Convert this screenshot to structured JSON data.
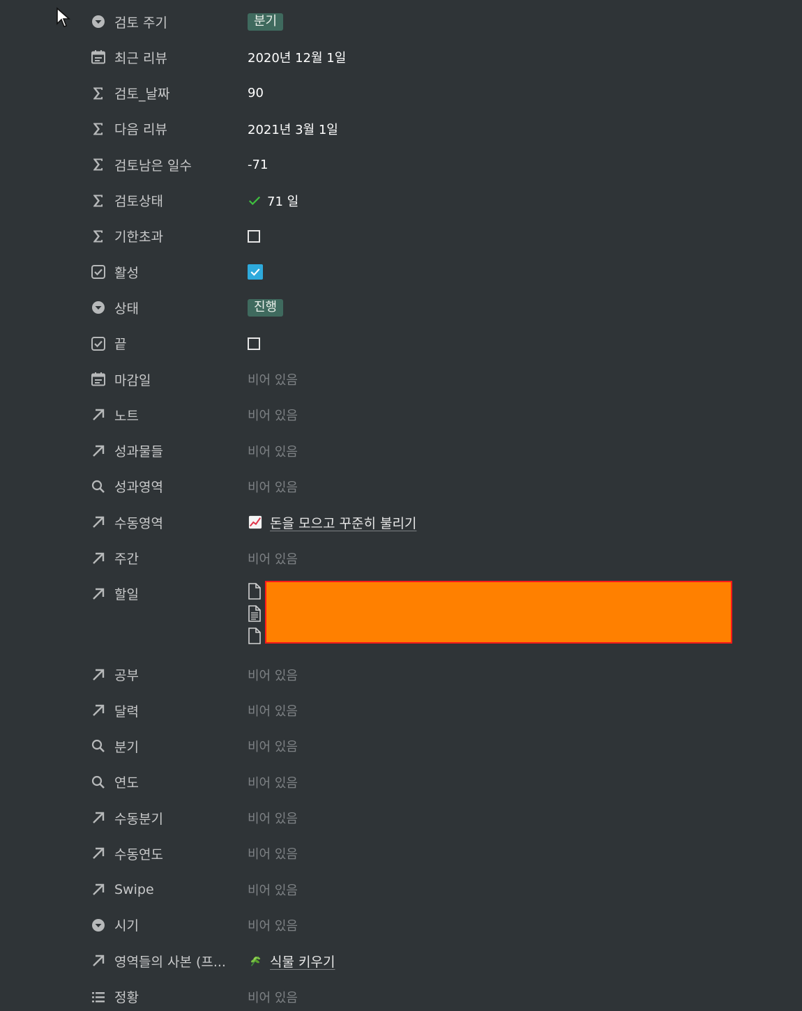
{
  "rows": [
    {
      "label": "검토 주기",
      "icon": "select-icon",
      "kind": "tag",
      "value": "분기"
    },
    {
      "label": "최근 리뷰",
      "icon": "calendar-icon",
      "kind": "text",
      "value": "2020년 12월 1일"
    },
    {
      "label": "검토_날짜",
      "icon": "formula-sigma-icon",
      "kind": "text",
      "value": "90"
    },
    {
      "label": "다음 리뷰",
      "icon": "formula-sigma-icon",
      "kind": "text",
      "value": "2021년 3월 1일"
    },
    {
      "label": "검토남은 일수",
      "icon": "formula-sigma-icon",
      "kind": "text",
      "value": "-71"
    },
    {
      "label": "검토상태",
      "icon": "formula-sigma-icon",
      "kind": "check-text",
      "value": "71 일"
    },
    {
      "label": "기한초과",
      "icon": "formula-sigma-icon",
      "kind": "checkbox",
      "checked": false
    },
    {
      "label": "활성",
      "icon": "checkbox-property-icon",
      "kind": "checkbox",
      "checked": true
    },
    {
      "label": "상태",
      "icon": "select-icon",
      "kind": "tag",
      "value": "진행"
    },
    {
      "label": "끝",
      "icon": "checkbox-property-icon",
      "kind": "checkbox",
      "checked": false
    },
    {
      "label": "마감일",
      "icon": "calendar-icon",
      "kind": "empty",
      "value": "비어 있음"
    },
    {
      "label": "노트",
      "icon": "relation-arrow-icon",
      "kind": "empty",
      "value": "비어 있음"
    },
    {
      "label": "성과물들",
      "icon": "relation-arrow-icon",
      "kind": "empty",
      "value": "비어 있음"
    },
    {
      "label": "성과영역",
      "icon": "rollup-search-icon",
      "kind": "empty",
      "value": "비어 있음"
    },
    {
      "label": "수동영역",
      "icon": "relation-arrow-icon",
      "kind": "link",
      "emoji": "chart-increasing-emoji",
      "value": "돈을 모으고 꾸준히 불리기"
    },
    {
      "label": "주간",
      "icon": "relation-arrow-icon",
      "kind": "empty",
      "value": "비어 있음"
    },
    {
      "label": "할일",
      "icon": "relation-arrow-icon",
      "kind": "todos"
    },
    {
      "label": "공부",
      "icon": "relation-arrow-icon",
      "kind": "empty",
      "value": "비어 있음"
    },
    {
      "label": "달력",
      "icon": "relation-arrow-icon",
      "kind": "empty",
      "value": "비어 있음"
    },
    {
      "label": "분기",
      "icon": "rollup-search-icon",
      "kind": "empty",
      "value": "비어 있음"
    },
    {
      "label": "연도",
      "icon": "rollup-search-icon",
      "kind": "empty",
      "value": "비어 있음"
    },
    {
      "label": "수동분기",
      "icon": "relation-arrow-icon",
      "kind": "empty",
      "value": "비어 있음"
    },
    {
      "label": "수동연도",
      "icon": "relation-arrow-icon",
      "kind": "empty",
      "value": "비어 있음"
    },
    {
      "label": "Swipe",
      "icon": "relation-arrow-icon",
      "kind": "empty",
      "value": "비어 있음"
    },
    {
      "label": "시기",
      "icon": "select-icon",
      "kind": "empty",
      "value": "비어 있음"
    },
    {
      "label": "영역들의 사본 (프...",
      "icon": "relation-arrow-icon",
      "kind": "link",
      "emoji": "herb-emoji",
      "value": "식물 키우기"
    },
    {
      "label": "정황",
      "icon": "multi-select-list-icon",
      "kind": "empty",
      "value": "비어 있음"
    }
  ],
  "todos": {
    "items": [
      {
        "icon": "page-icon"
      },
      {
        "icon": "page-text-icon"
      },
      {
        "icon": "page-icon"
      }
    ],
    "redaction_color": "#ff8000"
  },
  "colors": {
    "background": "#2f3437",
    "tag": "#3f6a5e",
    "checkbox_checked": "#2eaadc",
    "empty_text": "#7d8184"
  }
}
